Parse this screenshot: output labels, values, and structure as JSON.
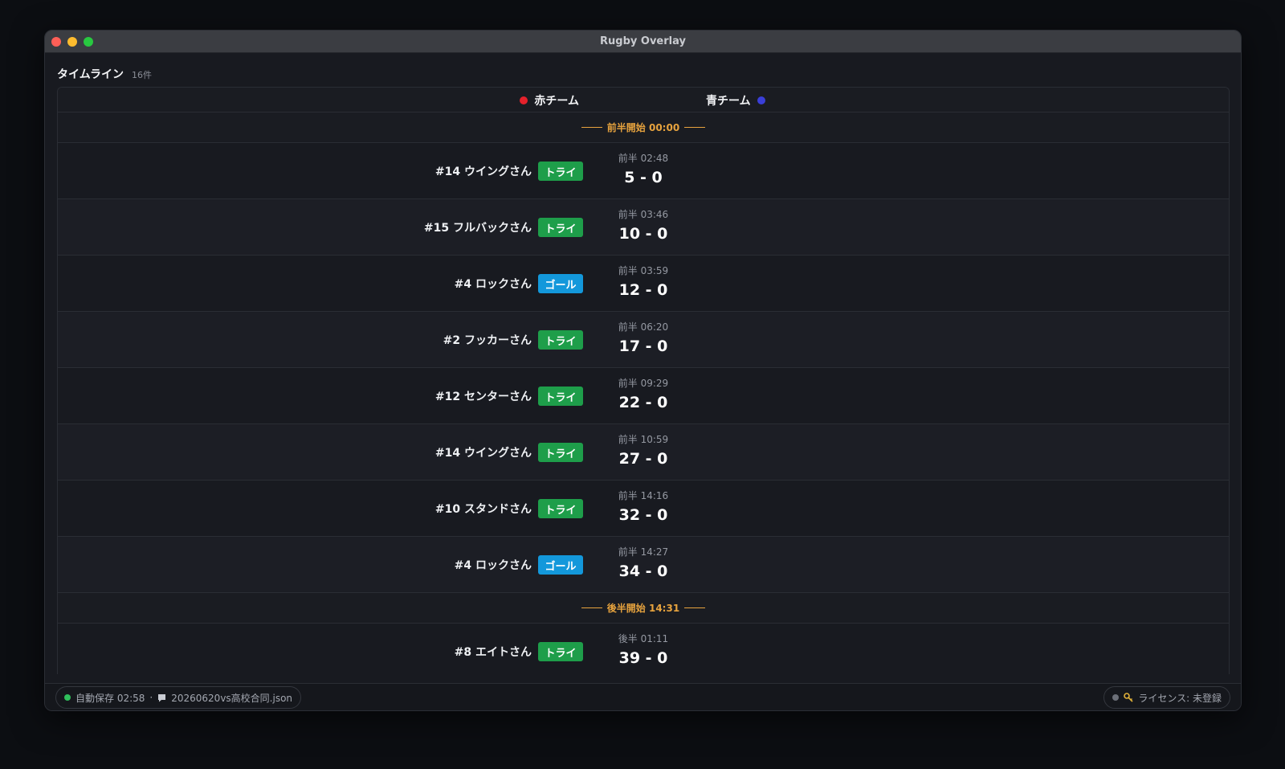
{
  "window": {
    "title": "Rugby Overlay",
    "traffic_colors": [
      "#ff5f57",
      "#febc2e",
      "#28c840"
    ]
  },
  "timeline": {
    "title": "タイムライン",
    "count": "16件"
  },
  "teams": {
    "red": {
      "name": "赤チーム",
      "color": "#e5212b"
    },
    "blue": {
      "name": "青チーム",
      "color": "#3a3fd8"
    }
  },
  "colors": {
    "try": "#1e9e4a",
    "goal": "#1398db",
    "divider": "#e7a33e"
  },
  "rows": [
    {
      "type": "divider",
      "text": "前半開始 00:00"
    },
    {
      "type": "event",
      "player": "#14 ウイングさん",
      "badge": "トライ",
      "kind": "try",
      "time": "前半 02:48",
      "score": "5 - 0"
    },
    {
      "type": "event",
      "player": "#15 フルバックさん",
      "badge": "トライ",
      "kind": "try",
      "time": "前半 03:46",
      "score": "10 - 0"
    },
    {
      "type": "event",
      "player": "#4 ロックさん",
      "badge": "ゴール",
      "kind": "goal",
      "time": "前半 03:59",
      "score": "12 - 0"
    },
    {
      "type": "event",
      "player": "#2 フッカーさん",
      "badge": "トライ",
      "kind": "try",
      "time": "前半 06:20",
      "score": "17 - 0"
    },
    {
      "type": "event",
      "player": "#12 センターさん",
      "badge": "トライ",
      "kind": "try",
      "time": "前半 09:29",
      "score": "22 - 0"
    },
    {
      "type": "event",
      "player": "#14 ウイングさん",
      "badge": "トライ",
      "kind": "try",
      "time": "前半 10:59",
      "score": "27 - 0"
    },
    {
      "type": "event",
      "player": "#10 スタンドさん",
      "badge": "トライ",
      "kind": "try",
      "time": "前半 14:16",
      "score": "32 - 0"
    },
    {
      "type": "event",
      "player": "#4 ロックさん",
      "badge": "ゴール",
      "kind": "goal",
      "time": "前半 14:27",
      "score": "34 - 0"
    },
    {
      "type": "divider",
      "text": "後半開始 14:31"
    },
    {
      "type": "event",
      "player": "#8 エイトさん",
      "badge": "トライ",
      "kind": "try",
      "time": "後半 01:11",
      "score": "39 - 0"
    }
  ],
  "status": {
    "autosave": "自動保存 02:58",
    "separator": "·",
    "file_icon": "document-icon",
    "file": "20260620vs高校合同.json",
    "autosave_color": "#2fbf5b",
    "license_icon": "key-icon",
    "license": "ライセンス: 未登録",
    "license_color": "#6b6f78"
  }
}
